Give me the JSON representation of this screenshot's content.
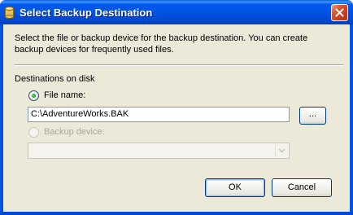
{
  "window": {
    "title": "Select Backup Destination",
    "close_label": "✕"
  },
  "description": "Select the file or backup device for the backup destination. You can create backup devices for frequently used files.",
  "destinations": {
    "section_label": "Destinations on disk",
    "file_name_label": "File name:",
    "file_name_value": "C:\\AdventureWorks.BAK",
    "browse_label": "...",
    "backup_device_label": "Backup device:",
    "backup_device_value": ""
  },
  "buttons": {
    "ok": "OK",
    "cancel": "Cancel"
  },
  "colors": {
    "title_bar": "#0054e3",
    "dialog_bg": "#ece9d8",
    "close_button": "#c33d1b",
    "radio_selected": "#21a121"
  },
  "icons": {
    "title": "database-cylinder-icon",
    "close": "close-icon",
    "dropdown": "chevron-down-icon"
  }
}
